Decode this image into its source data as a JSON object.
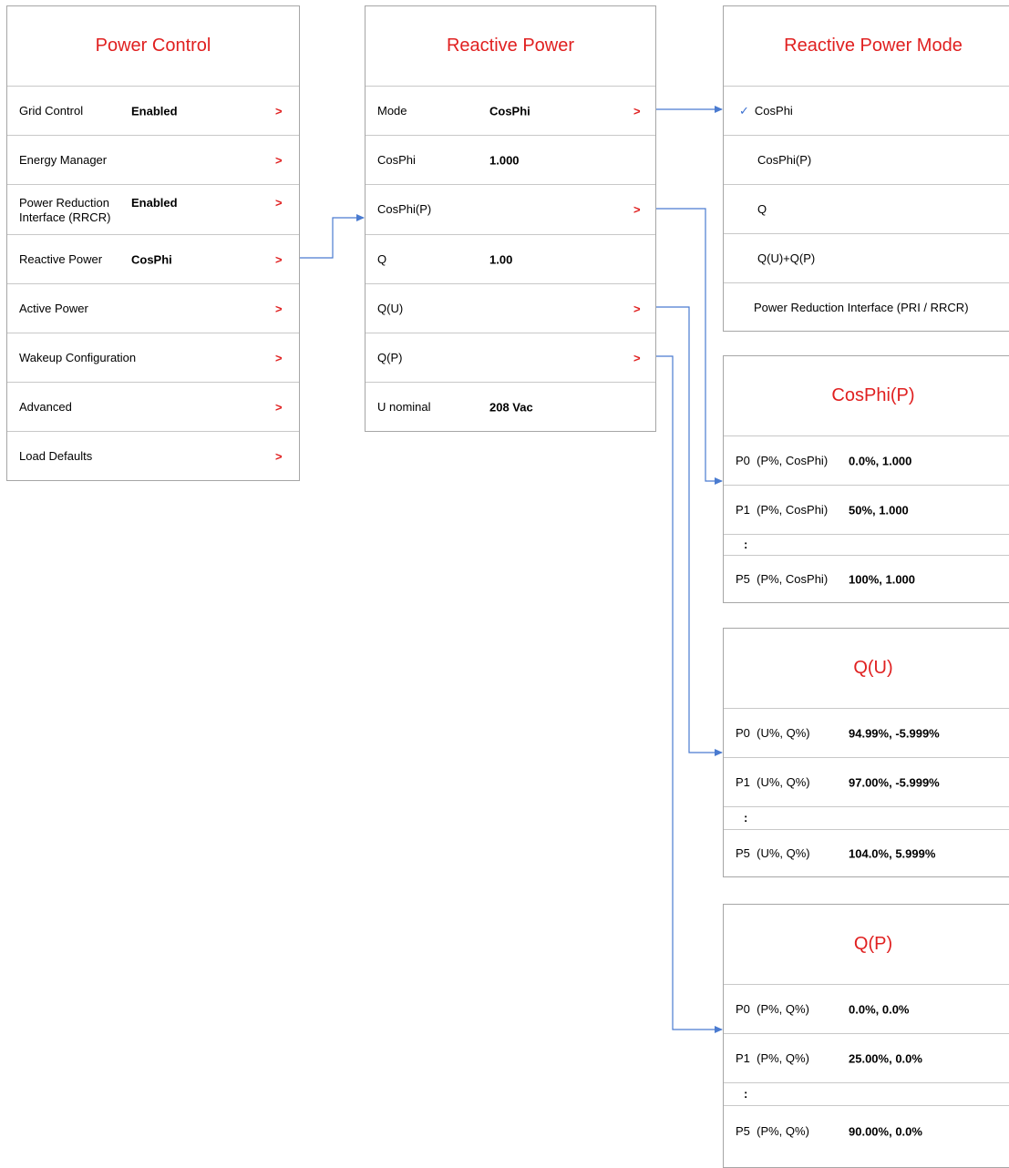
{
  "power_control": {
    "title": "Power Control",
    "rows": [
      {
        "label": "Grid Control",
        "value": "Enabled",
        "chevron": ">"
      },
      {
        "label": "Energy Manager",
        "value": "",
        "chevron": ">"
      },
      {
        "label": "Power Reduction\nInterface (RRCR)",
        "value": "Enabled",
        "chevron": ">"
      },
      {
        "label": "Reactive Power",
        "value": "CosPhi",
        "chevron": ">"
      },
      {
        "label": "Active Power",
        "value": "",
        "chevron": ">"
      },
      {
        "label": "Wakeup Configuration",
        "value": "",
        "chevron": ">"
      },
      {
        "label": "Advanced",
        "value": "",
        "chevron": ">"
      },
      {
        "label": "Load Defaults",
        "value": "",
        "chevron": ">"
      }
    ]
  },
  "reactive_power": {
    "title": "Reactive Power",
    "rows": [
      {
        "label": "Mode",
        "value": "CosPhi",
        "chevron": ">"
      },
      {
        "label": "CosPhi",
        "value": "1.000",
        "chevron": ""
      },
      {
        "label": "CosPhi(P)",
        "value": "",
        "chevron": ">"
      },
      {
        "label": "Q",
        "value": "1.00",
        "chevron": ""
      },
      {
        "label": "Q(U)",
        "value": "",
        "chevron": ">"
      },
      {
        "label": "Q(P)",
        "value": "",
        "chevron": ">"
      },
      {
        "label": "U nominal",
        "value": "208 Vac",
        "chevron": ""
      }
    ]
  },
  "reactive_power_mode": {
    "title": "Reactive Power Mode",
    "check_glyph": "✓",
    "options": [
      {
        "label": "CosPhi",
        "selected": true
      },
      {
        "label": "CosPhi(P)",
        "selected": false
      },
      {
        "label": "Q",
        "selected": false
      },
      {
        "label": "Q(U)+Q(P)",
        "selected": false
      },
      {
        "label": "Power Reduction Interface (PRI / RRCR)",
        "selected": false
      }
    ]
  },
  "cosphi_p": {
    "title": "CosPhi(P)",
    "rows": [
      {
        "label": "P0  (P%, CosPhi)",
        "value": "0.0%, 1.000"
      },
      {
        "label": "P1  (P%, CosPhi)",
        "value": "50%, 1.000"
      },
      {
        "label": ":",
        "value": ""
      },
      {
        "label": "P5  (P%, CosPhi)",
        "value": "100%, 1.000"
      }
    ]
  },
  "q_u": {
    "title": "Q(U)",
    "rows": [
      {
        "label": "P0  (U%, Q%)",
        "value": "94.99%, -5.999%"
      },
      {
        "label": "P1  (U%, Q%)",
        "value": "97.00%, -5.999%"
      },
      {
        "label": ":",
        "value": ""
      },
      {
        "label": "P5  (U%, Q%)",
        "value": "104.0%, 5.999%"
      }
    ]
  },
  "q_p": {
    "title": "Q(P)",
    "rows": [
      {
        "label": "P0  (P%, Q%)",
        "value": "0.0%, 0.0%"
      },
      {
        "label": "P1  (P%, Q%)",
        "value": "25.00%, 0.0%"
      },
      {
        "label": ":",
        "value": ""
      },
      {
        "label": "P5  (P%, Q%)",
        "value": "90.00%, 0.0%"
      }
    ]
  },
  "colors": {
    "title": "#e02020",
    "chevron": "#e02020",
    "connector": "#4a7bd0",
    "border": "#a6a6a6"
  }
}
